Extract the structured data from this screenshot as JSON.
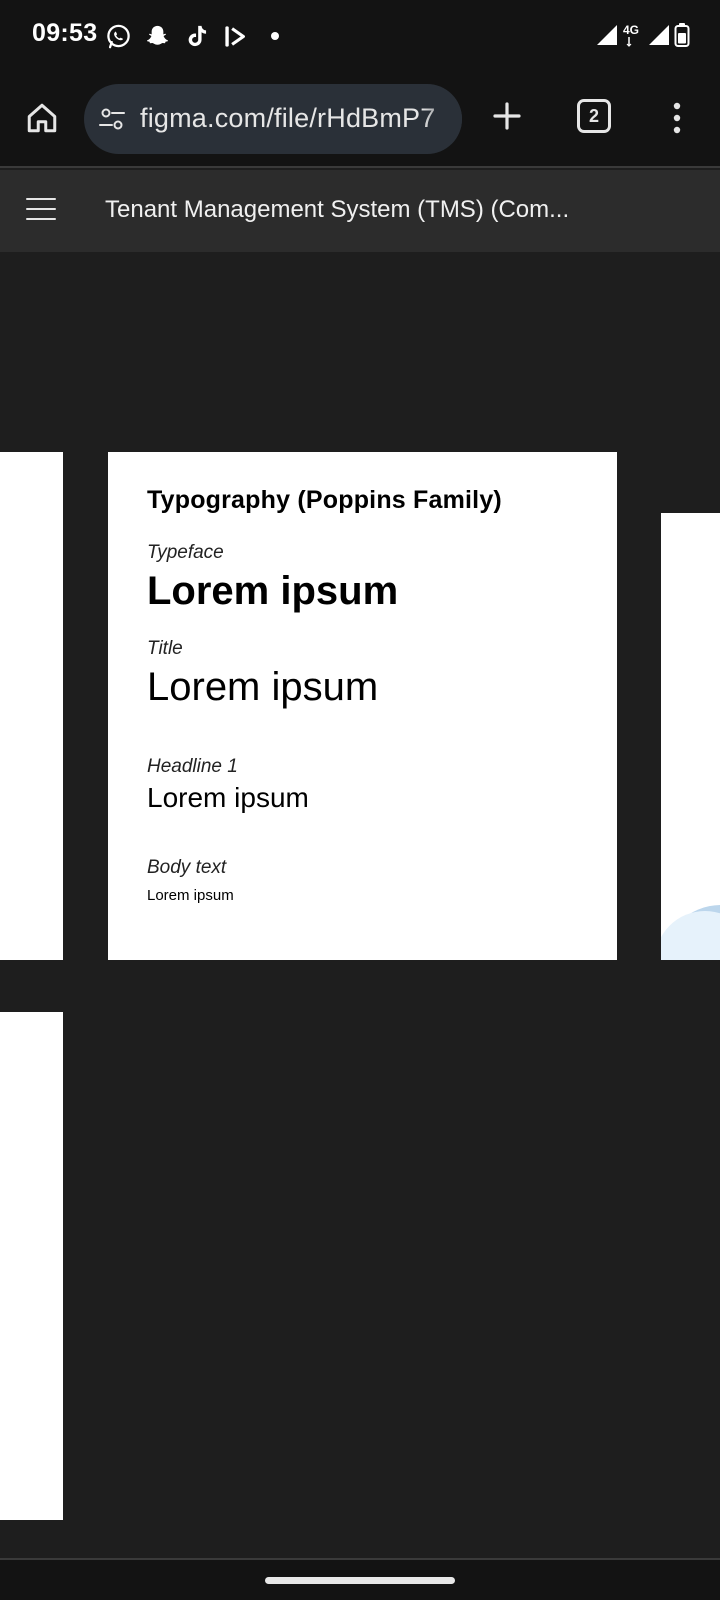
{
  "status_bar": {
    "time": "09:53",
    "notification_icons": [
      "whatsapp-icon",
      "snapchat-icon",
      "tiktok-icon",
      "bixby-icon",
      "dot-icon"
    ],
    "network_label": "4G",
    "system_icons": [
      "signal-icon",
      "signal-icon",
      "battery-icon"
    ]
  },
  "browser": {
    "url": "figma.com/file/rHdBmP7",
    "tab_count": "2",
    "icons": [
      "home-icon",
      "site-settings-icon",
      "plus-icon",
      "tabs-icon",
      "more-vert-icon"
    ]
  },
  "figma": {
    "file_title": "Tenant Management System (TMS) (Com...",
    "menu_icon": "hamburger-icon"
  },
  "typography_card": {
    "heading": "Typography (Poppins Family)",
    "items": [
      {
        "label": "Typeface",
        "sample": "Lorem ipsum"
      },
      {
        "label": "Title",
        "sample": "Lorem ipsum"
      },
      {
        "label": "Headline 1",
        "sample": "Lorem ipsum"
      },
      {
        "label": "Body text",
        "sample": "Lorem ipsum"
      }
    ]
  },
  "colors": {
    "system_bar_bg": "#131313",
    "url_pill_bg": "#2a3038",
    "figma_header_bg": "#2c2c2c",
    "canvas_bg": "#1e1e1e",
    "frame_bg": "#ffffff"
  }
}
